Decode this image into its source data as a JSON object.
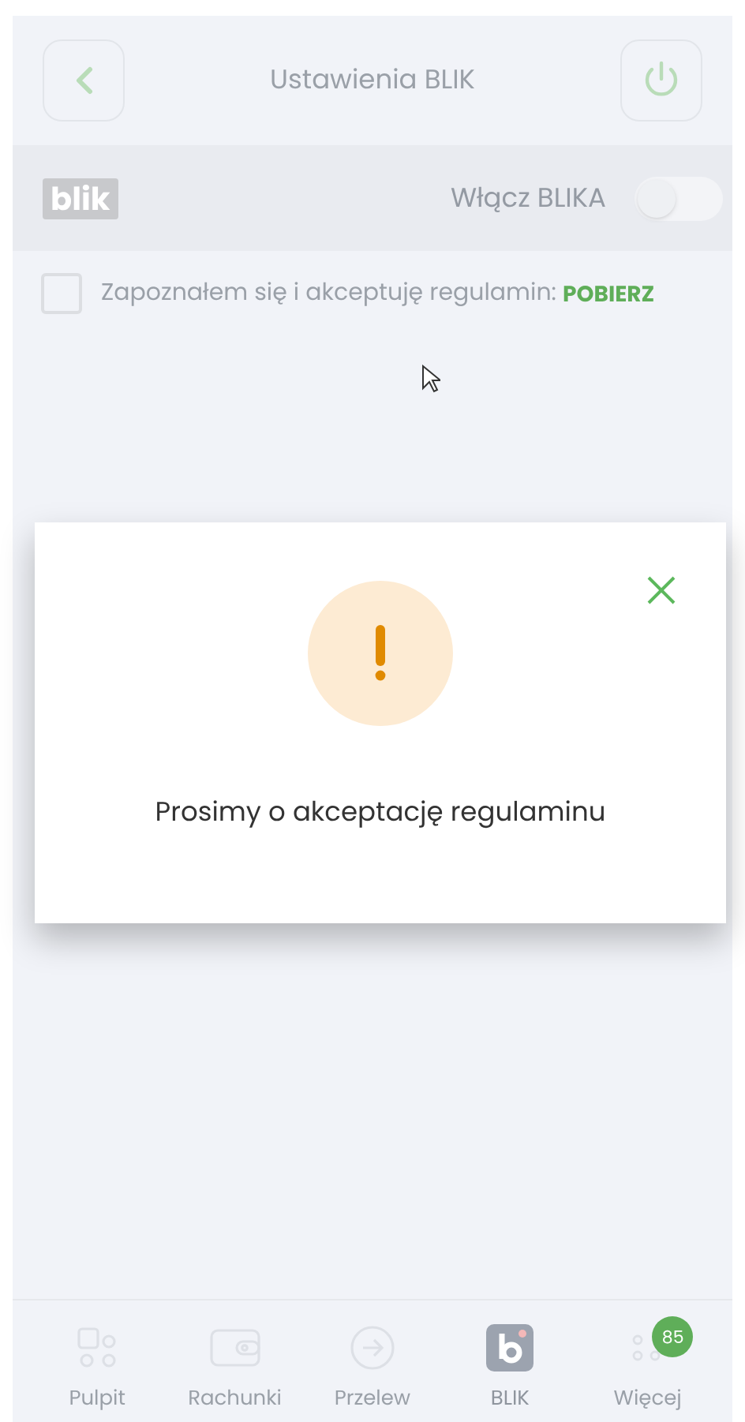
{
  "header": {
    "title": "Ustawienia BLIK"
  },
  "blik_row": {
    "logo": "blik",
    "label": "Włącz BLIKA",
    "on": false
  },
  "terms": {
    "text": "Zapoznałem się i akceptuję regulamin:",
    "link": "POBIERZ",
    "checked": false
  },
  "dialog": {
    "message": "Prosimy o akceptację regulaminu"
  },
  "nav": [
    {
      "kind": "grid",
      "label": "Pulpit",
      "selected": false
    },
    {
      "kind": "wallet",
      "label": "Rachunki",
      "selected": false
    },
    {
      "kind": "arrow",
      "label": "Przelew",
      "selected": false
    },
    {
      "kind": "blik",
      "label": "BLIK",
      "selected": true
    },
    {
      "kind": "more",
      "label": "Więcej",
      "selected": false,
      "badge": "85"
    }
  ]
}
